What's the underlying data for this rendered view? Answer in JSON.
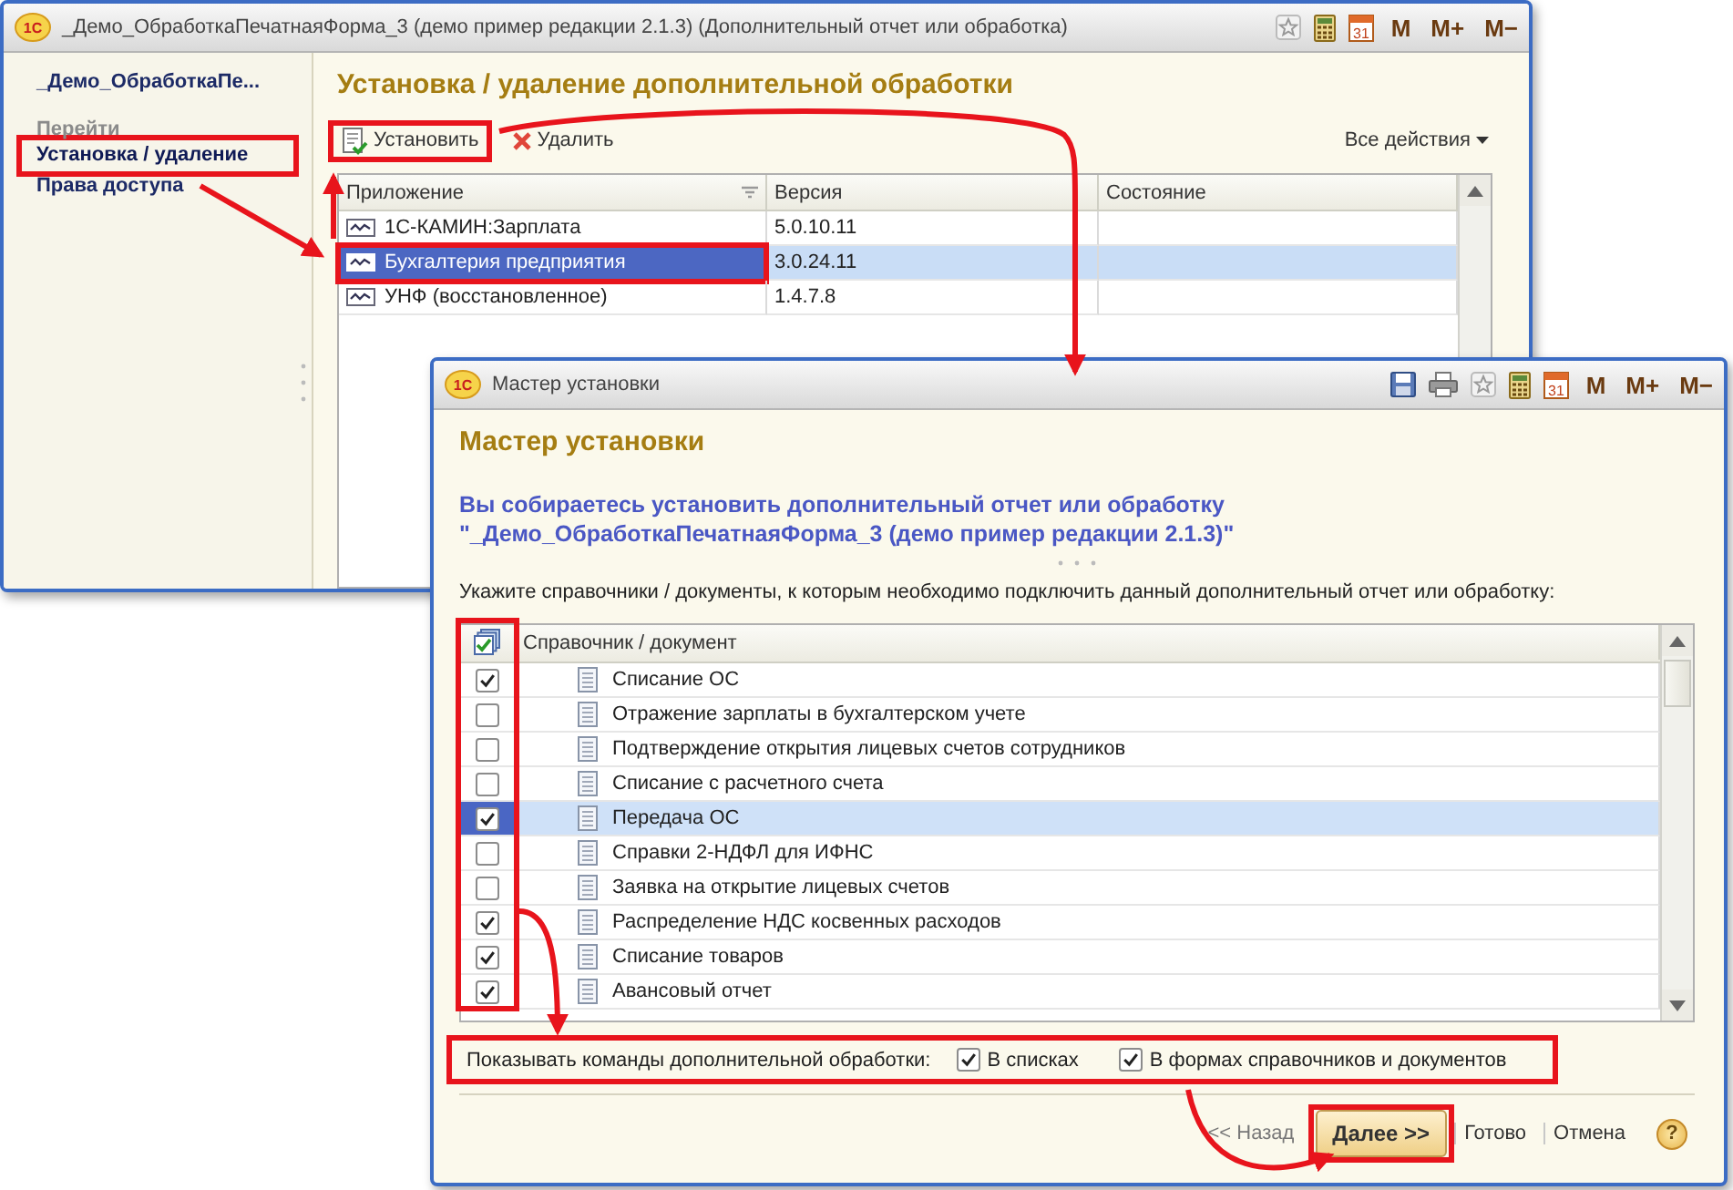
{
  "main_window": {
    "logo": "1С",
    "title": "_Демо_ОбработкаПечатнаяФорма_3 (демо пример редакции 2.1.3) (Дополнительный отчет или обработка)",
    "calendar_day": "31",
    "memory_buttons": [
      "M",
      "M+",
      "M−"
    ],
    "sidebar": {
      "title": "_Демо_ОбработкаПе...",
      "section": "Перейти",
      "items": [
        {
          "label": "Установка / удаление",
          "selected": true
        },
        {
          "label": "Права доступа",
          "selected": false
        }
      ]
    },
    "heading": "Установка / удаление дополнительной обработки",
    "toolbar": {
      "install": "Установить",
      "delete": "Удалить",
      "all_actions": "Все действия"
    },
    "table": {
      "columns": [
        "Приложение",
        "Версия",
        "Состояние"
      ],
      "rows": [
        {
          "application": "1С-КАМИН:Зарплата",
          "version": "5.0.10.11",
          "selected": false
        },
        {
          "application": "Бухгалтерия предприятия",
          "version": "3.0.24.11",
          "selected": true
        },
        {
          "application": "УНФ (восстановленное)",
          "version": "1.4.7.8",
          "selected": false
        }
      ]
    }
  },
  "wizard": {
    "logo": "1С",
    "title": "Мастер установки",
    "calendar_day": "31",
    "memory_buttons": [
      "M",
      "M+",
      "M−"
    ],
    "heading": "Мастер установки",
    "message": "Вы собираетесь установить дополнительный отчет или обработку \"_Демо_ОбработкаПечатнаяФорма_3 (демо пример редакции 2.1.3)\"",
    "instruction": "Укажите справочники / документы, к которым необходимо подключить данный дополнительный отчет или обработку:",
    "table": {
      "column": "Справочник / документ",
      "rows": [
        {
          "name": "Списание ОС",
          "checked": true,
          "selected": false
        },
        {
          "name": "Отражение зарплаты в бухгалтерском учете",
          "checked": false,
          "selected": false
        },
        {
          "name": "Подтверждение открытия лицевых счетов сотрудников",
          "checked": false,
          "selected": false
        },
        {
          "name": "Списание с расчетного счета",
          "checked": false,
          "selected": false
        },
        {
          "name": "Передача ОС",
          "checked": true,
          "selected": true
        },
        {
          "name": "Справки 2-НДФЛ для ИФНС",
          "checked": false,
          "selected": false
        },
        {
          "name": "Заявка на открытие лицевых счетов",
          "checked": false,
          "selected": false
        },
        {
          "name": "Распределение НДС косвенных расходов",
          "checked": true,
          "selected": false
        },
        {
          "name": "Списание товаров",
          "checked": true,
          "selected": false
        },
        {
          "name": "Авансовый отчет",
          "checked": true,
          "selected": false
        }
      ]
    },
    "options": {
      "label": "Показывать команды дополнительной обработки:",
      "checkboxes": [
        {
          "label": "В списках",
          "checked": true
        },
        {
          "label": "В формах справочников и документов",
          "checked": true
        }
      ]
    },
    "buttons": [
      {
        "label": "<< Назад",
        "kind": "back"
      },
      {
        "label": "Далее >>",
        "kind": "primary"
      },
      {
        "label": "Готово",
        "kind": "link"
      },
      {
        "label": "Отмена",
        "kind": "link"
      }
    ],
    "help": "?"
  }
}
